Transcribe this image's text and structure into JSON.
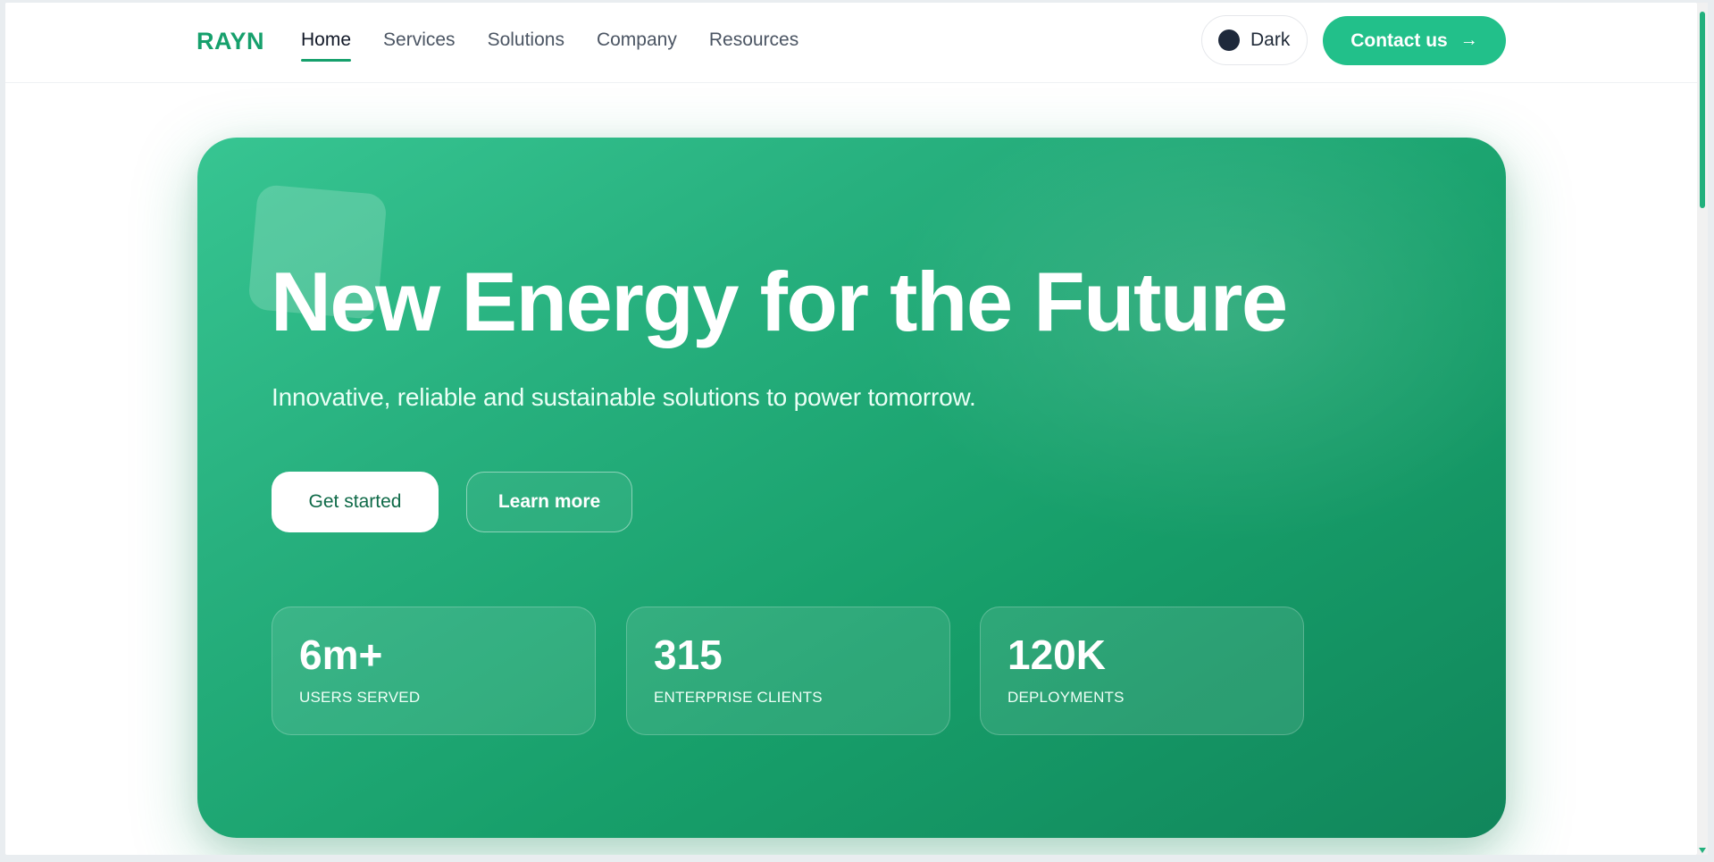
{
  "nav": {
    "logo": "RAYN",
    "links": [
      {
        "label": "Home",
        "active": true
      },
      {
        "label": "Services"
      },
      {
        "label": "Solutions"
      },
      {
        "label": "Company"
      },
      {
        "label": "Resources"
      }
    ],
    "theme_toggle_label": "Dark",
    "contact_label": "Contact us",
    "contact_icon": "arrow-right-icon"
  },
  "hero": {
    "title": "New Energy for the Future",
    "subtitle": "Innovative, reliable and sustainable solutions to power tomorrow.",
    "primary_button": "Get started",
    "secondary_button": "Learn more",
    "stats": [
      {
        "value": "6m+",
        "label": "USERS SERVED"
      },
      {
        "value": "315",
        "label": "ENTERPRISE CLIENTS"
      },
      {
        "value": "120K",
        "label": "DEPLOYMENTS"
      }
    ]
  },
  "colors": {
    "accent": "#22c08a",
    "brand": "#16a06c",
    "hero_gradient_start": "#37c592",
    "hero_gradient_end": "#11865b",
    "toggle_dot": "#1e293b"
  }
}
